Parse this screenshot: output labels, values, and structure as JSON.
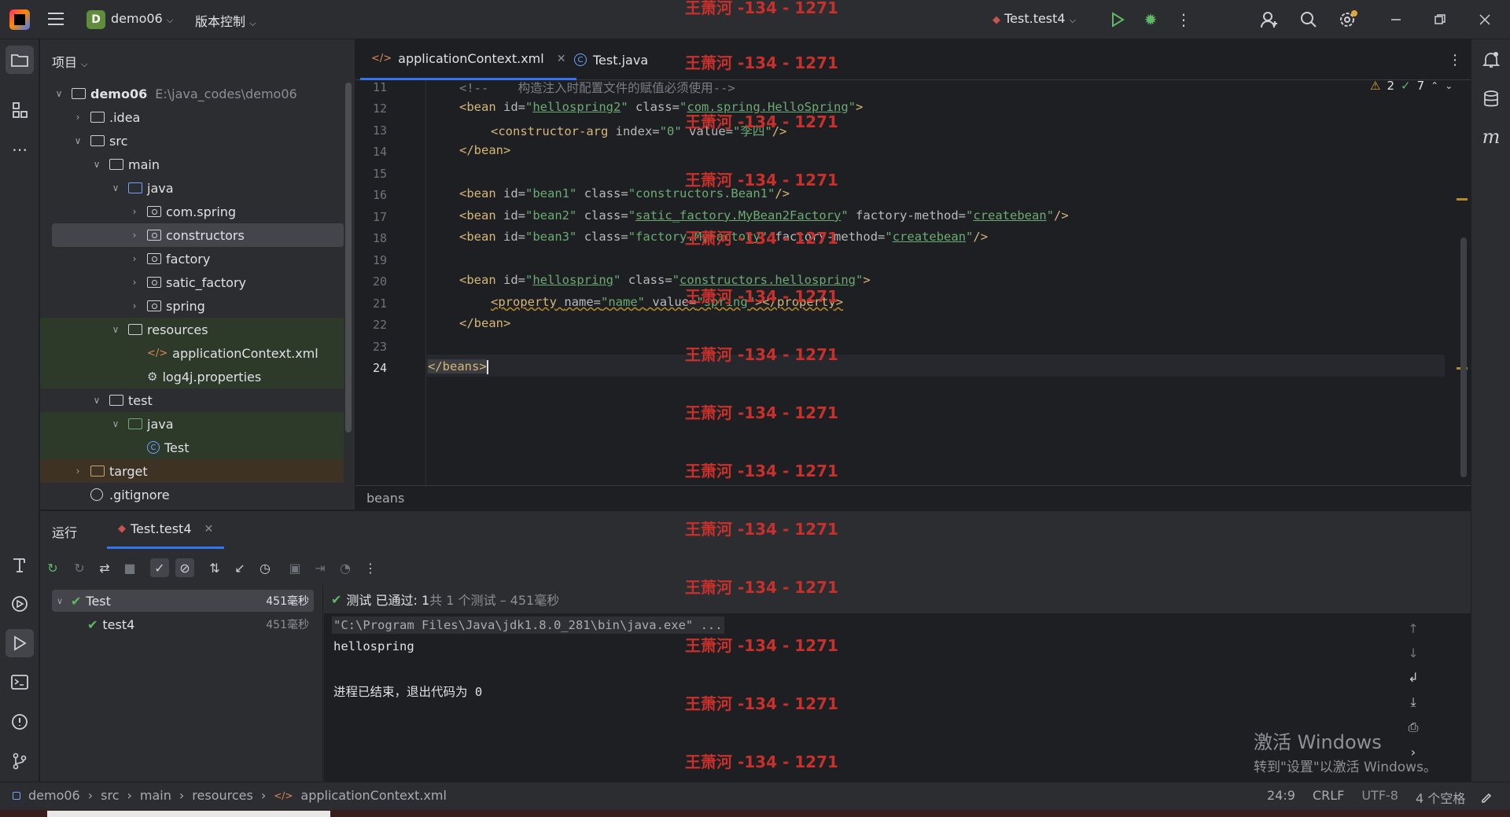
{
  "titlebar": {
    "project_badge": "D",
    "project_name": "demo06",
    "vcs_label": "版本控制",
    "run_config": "Test.test4"
  },
  "project_panel": {
    "title": "项目",
    "tree": [
      {
        "name": "demo06",
        "path": "E:\\java_codes\\demo06"
      },
      {
        "name": ".idea"
      },
      {
        "name": "src"
      },
      {
        "name": "main"
      },
      {
        "name": "java"
      },
      {
        "name": "com.spring"
      },
      {
        "name": "constructors"
      },
      {
        "name": "factory"
      },
      {
        "name": "satic_factory"
      },
      {
        "name": "spring"
      },
      {
        "name": "resources"
      },
      {
        "name": "applicationContext.xml"
      },
      {
        "name": "log4j.properties"
      },
      {
        "name": "test"
      },
      {
        "name": "java"
      },
      {
        "name": "Test"
      },
      {
        "name": "target"
      },
      {
        "name": ".gitignore"
      }
    ]
  },
  "editor": {
    "tabs": [
      {
        "label": "applicationContext.xml",
        "active": true
      },
      {
        "label": "Test.java",
        "active": false
      }
    ],
    "inspections": {
      "warnings": "2",
      "ok": "7"
    },
    "line_numbers": [
      "11",
      "12",
      "13",
      "14",
      "15",
      "16",
      "17",
      "18",
      "19",
      "20",
      "21",
      "22",
      "23",
      "24"
    ],
    "code": {
      "l11": "构造注入时配置文件的赋值必须使用-->",
      "l12_id": "hellospring2",
      "l12_class": "com.spring.HelloSpring",
      "l13_index": "0",
      "l13_value": "李四",
      "l16_id": "bean1",
      "l16_class": "constructors.Bean1",
      "l17_id": "bean2",
      "l17_class": "satic_factory.MyBean2Factory",
      "l17_method": "createbean",
      "l18_id": "bean3",
      "l18_class": "factory.MyFactory",
      "l18_method": "createbean",
      "l20_id": "hellospring",
      "l20_class": "constructors.hellospring",
      "l21_name": "name",
      "l21_value": "spring",
      "l24": "</beans>"
    },
    "breadcrumb": "beans"
  },
  "run_panel": {
    "title": "运行",
    "tab": "Test.test4",
    "tests": [
      {
        "name": "Test",
        "time": "451毫秒"
      },
      {
        "name": "test4",
        "time": "451毫秒"
      }
    ],
    "status_passed": "测试 已通过: 1",
    "status_summary": "共 1 个测试 – 451毫秒",
    "console": [
      "\"C:\\Program Files\\Java\\jdk1.8.0_281\\bin\\java.exe\" ...",
      "hellospring",
      "",
      "进程已结束，退出代码为 0"
    ]
  },
  "statusbar": {
    "crumbs": [
      "demo06",
      "src",
      "main",
      "resources",
      "applicationContext.xml"
    ],
    "position": "24:9",
    "line_sep": "CRLF",
    "encoding": "UTF-8",
    "indent": "4 个空格"
  },
  "watermark": "王萧河 -134 - 1271",
  "windows_activation": {
    "title": "激活 Windows",
    "subtitle": "转到\"设置\"以激活 Windows。"
  }
}
